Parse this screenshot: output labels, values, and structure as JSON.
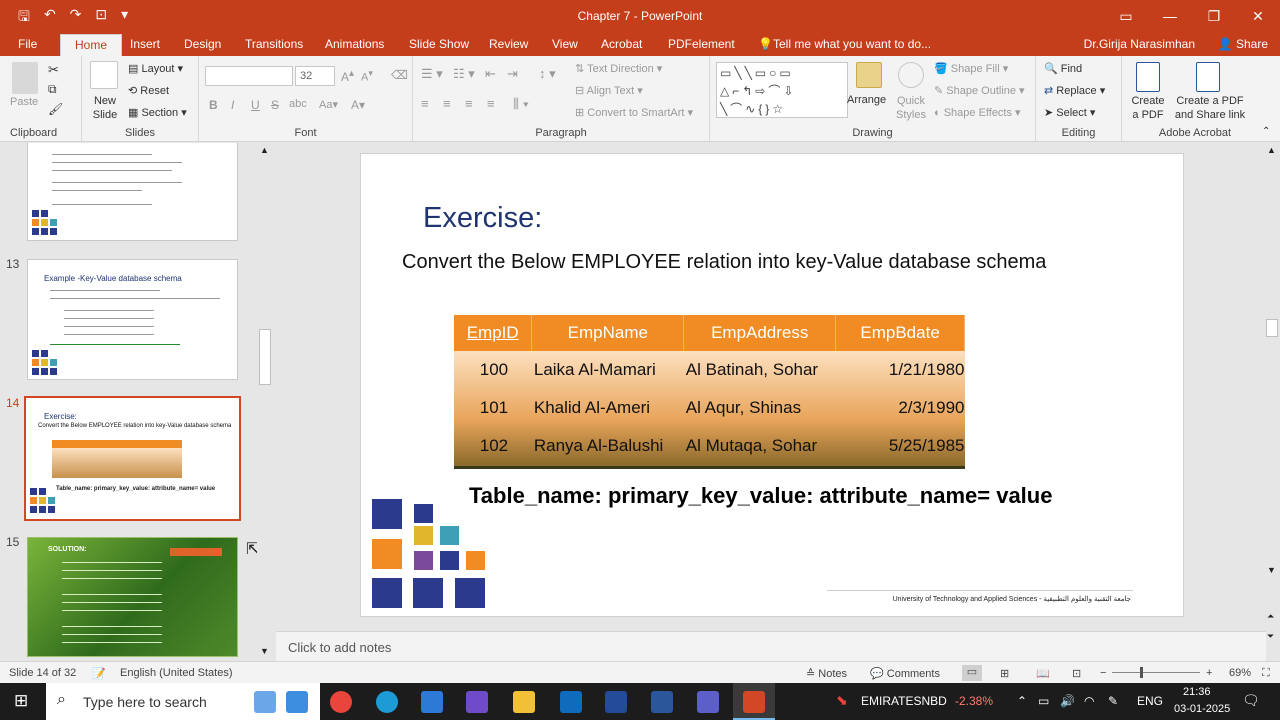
{
  "window": {
    "title": "Chapter 7 - PowerPoint",
    "user": "Dr.Girija Narasimhan",
    "share": "Share"
  },
  "tabs": [
    "File",
    "Home",
    "Insert",
    "Design",
    "Transitions",
    "Animations",
    "Slide Show",
    "Review",
    "View",
    "Acrobat",
    "PDFelement",
    "Tell me what you want to do..."
  ],
  "ribbon": {
    "clipboard": {
      "label": "Clipboard",
      "paste": "Paste"
    },
    "slides": {
      "label": "Slides",
      "new_slide": "New Slide",
      "layout": "Layout",
      "reset": "Reset",
      "section": "Section"
    },
    "font": {
      "label": "Font",
      "size": "32"
    },
    "paragraph": {
      "label": "Paragraph",
      "text_direction": "Text Direction",
      "align_text": "Align Text",
      "convert_smartart": "Convert to SmartArt"
    },
    "drawing": {
      "label": "Drawing",
      "arrange": "Arrange",
      "quick_styles": "Quick Styles",
      "shape_fill": "Shape Fill",
      "shape_outline": "Shape Outline",
      "shape_effects": "Shape Effects"
    },
    "editing": {
      "label": "Editing",
      "find": "Find",
      "replace": "Replace",
      "select": "Select"
    },
    "acrobat": {
      "label": "Adobe Acrobat",
      "create_pdf": "Create a PDF",
      "create_share": "Create a PDF and Share link"
    }
  },
  "thumbnails": {
    "n13": "13",
    "n14": "14",
    "n15": "15",
    "t13_title": "Example -Key-Value database schema",
    "t14_title": "Exercise:",
    "t14_sub": "Convert the Below EMPLOYEE relation into key-Value database schema",
    "t14_formula": "Table_name: primary_key_value: attribute_name= value",
    "t15_title": "SOLUTION:"
  },
  "slide": {
    "heading": "Exercise:",
    "subtitle": "Convert the Below EMPLOYEE relation into key-Value database schema",
    "table": {
      "headers": [
        "EmpID",
        "EmpName",
        "EmpAddress",
        "EmpBdate"
      ],
      "rows": [
        [
          "100",
          "Laika Al-Mamari",
          "Al Batinah, Sohar",
          "1/21/1980"
        ],
        [
          "101",
          "Khalid Al-Ameri",
          "Al Aqur, Shinas",
          "2/3/1990"
        ],
        [
          "102",
          "Ranya Al-Balushi",
          "Al Mutaqa, Sohar",
          "5/25/1985"
        ]
      ]
    },
    "formula": "Table_name: primary_key_value: attribute_name= value",
    "footer": "University of Technology and Applied Sciences - جامعة التقنية والعلوم التطبيقية"
  },
  "notes_placeholder": "Click to add notes",
  "status": {
    "slide_info": "Slide 14 of 32",
    "language": "English (United States)",
    "notes": "Notes",
    "comments": "Comments",
    "zoom": "69%"
  },
  "taskbar": {
    "search_placeholder": "Type here to search",
    "ticker_name": "EMIRATESNBD",
    "ticker_change": "-2.38%",
    "lang": "ENG",
    "time": "21:36",
    "date": "03-01-2025"
  },
  "colors": {
    "accent": "#c43e1c",
    "table_header": "#f18c24",
    "heading": "#1f3470"
  }
}
